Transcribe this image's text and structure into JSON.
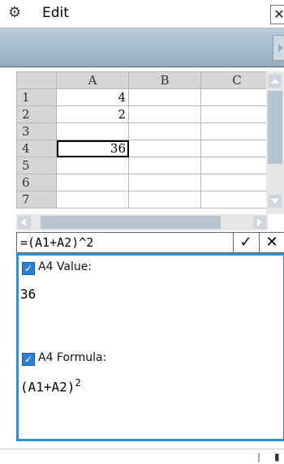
{
  "menubar": {
    "menu_label": "Edit",
    "close_glyph": "✕",
    "settings_icon": "gear-icon"
  },
  "sheet": {
    "columns": [
      "A",
      "B",
      "C"
    ],
    "rows": [
      {
        "header": "1",
        "A": "4",
        "B": "",
        "C": ""
      },
      {
        "header": "2",
        "A": "2",
        "B": "",
        "C": ""
      },
      {
        "header": "3",
        "A": "",
        "B": "",
        "C": ""
      },
      {
        "header": "4",
        "A": "36",
        "B": "",
        "C": ""
      },
      {
        "header": "5",
        "A": "",
        "B": "",
        "C": ""
      },
      {
        "header": "6",
        "A": "",
        "B": "",
        "C": ""
      },
      {
        "header": "7",
        "A": "",
        "B": "",
        "C": ""
      }
    ],
    "selected_cell": "A4"
  },
  "formula_bar": {
    "text": "=(A1+A2)^2",
    "ok_glyph": "✓",
    "cancel_glyph": "✕"
  },
  "panel": {
    "value_label": "A4 Value:",
    "value": "36",
    "formula_label": "A4 Formula:",
    "formula_base": "(A1+A2)",
    "formula_exp": "2"
  },
  "colors": {
    "accent": "#2f8fcf",
    "toolbar": "#a9bfcf"
  }
}
